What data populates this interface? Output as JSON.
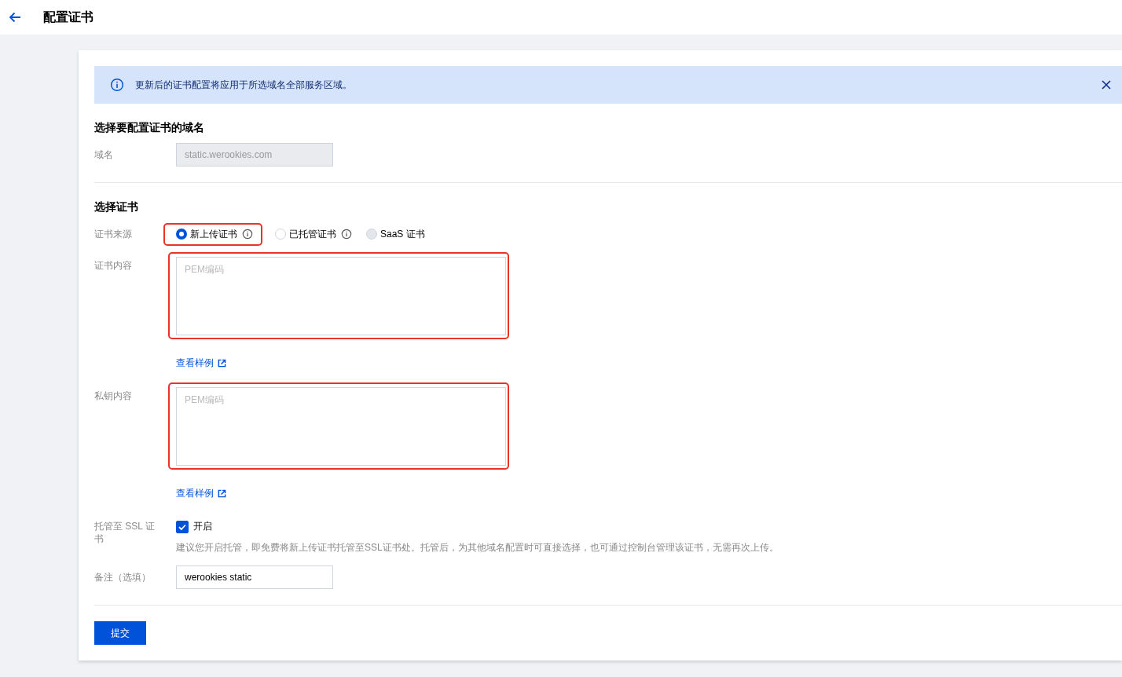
{
  "header": {
    "title": "配置证书"
  },
  "alert": {
    "text": "更新后的证书配置将应用于所选域名全部服务区域。"
  },
  "domain_section": {
    "heading": "选择要配置证书的域名",
    "label": "域名",
    "value": "static.werookies.com",
    "disabled": true
  },
  "cert_section": {
    "heading": "选择证书",
    "source": {
      "label": "证书来源",
      "highlighted": true,
      "options": [
        {
          "label": "新上传证书",
          "selected": true,
          "disabled": false,
          "info": true
        },
        {
          "label": "已托管证书",
          "selected": false,
          "disabled": false,
          "info": true
        },
        {
          "label": "SaaS 证书",
          "selected": false,
          "disabled": true,
          "info": false
        }
      ]
    },
    "cert_content": {
      "label": "证书内容",
      "placeholder": "PEM编码",
      "highlighted": true,
      "link": "查看样例"
    },
    "key_content": {
      "label": "私钥内容",
      "placeholder": "PEM编码",
      "highlighted": true,
      "link": "查看样例"
    },
    "hosting": {
      "label": "托管至 SSL 证书",
      "checkbox_label": "开启",
      "checked": true,
      "hint": "建议您开启托管，即免费将新上传证书托管至SSL证书处。托管后，为其他域名配置时可直接选择，也可通过控制台管理该证书，无需再次上传。"
    },
    "remark": {
      "label": "备注（选填）",
      "value": "werookies static"
    }
  },
  "submit": "提交"
}
